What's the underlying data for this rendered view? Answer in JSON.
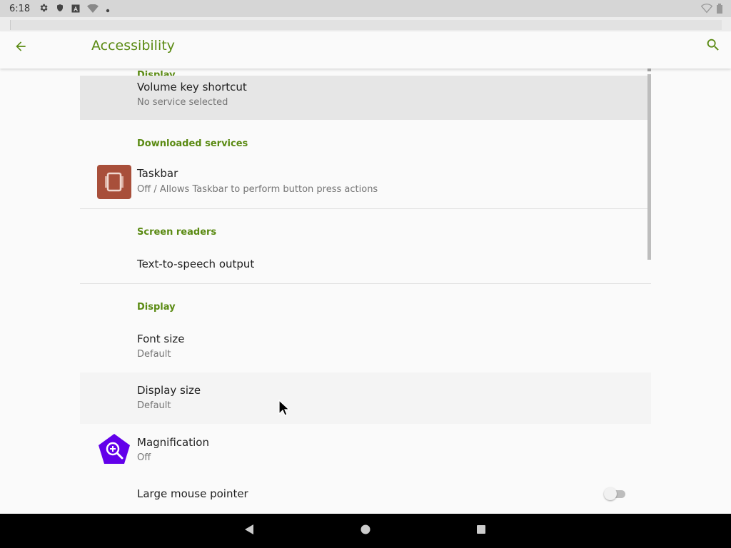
{
  "status_bar": {
    "time": "6:18",
    "icons": [
      "settings-icon",
      "shield-icon",
      "a-icon",
      "wifi-off-icon",
      "dot-icon"
    ],
    "right_icons": [
      "wifi-icon",
      "battery-icon"
    ]
  },
  "app_bar": {
    "title": "Accessibility",
    "back_icon": "arrow-back-icon",
    "search_icon": "search-icon",
    "accent_color": "#5a8a12"
  },
  "sections": {
    "partial_header": "Display",
    "volume_key": {
      "title": "Volume key shortcut",
      "subtitle": "No service selected"
    },
    "downloaded_services": {
      "header": "Downloaded services",
      "taskbar": {
        "title": "Taskbar",
        "subtitle": "Off / Allows Taskbar to perform button press actions",
        "icon_color": "#a84f3a"
      }
    },
    "screen_readers": {
      "header": "Screen readers",
      "tts": {
        "title": "Text-to-speech output"
      }
    },
    "display": {
      "header": "Display",
      "font_size": {
        "title": "Font size",
        "subtitle": "Default"
      },
      "display_size": {
        "title": "Display size",
        "subtitle": "Default"
      },
      "magnification": {
        "title": "Magnification",
        "subtitle": "Off",
        "icon_color": "#6200ea"
      },
      "large_mouse_pointer": {
        "title": "Large mouse pointer",
        "enabled": false
      }
    }
  },
  "nav_bar": {
    "buttons": [
      "back-triangle-icon",
      "home-circle-icon",
      "recents-square-icon"
    ]
  }
}
